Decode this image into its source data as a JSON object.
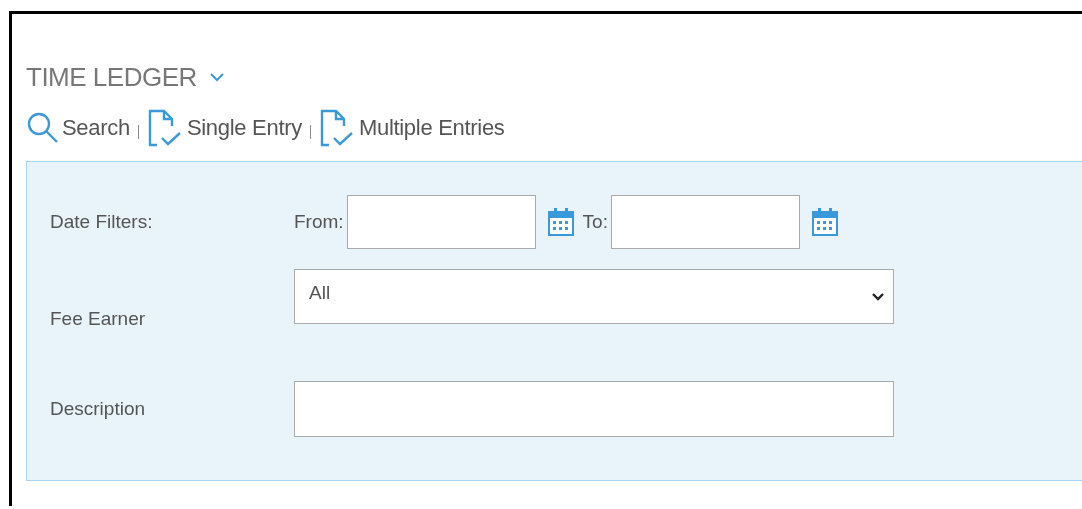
{
  "header": {
    "title": "TIME LEDGER"
  },
  "toolbar": [
    {
      "kind": "search",
      "label": "Search"
    },
    {
      "kind": "document",
      "label": "Single Entry"
    },
    {
      "kind": "document",
      "label": "Multiple Entries"
    }
  ],
  "filters": {
    "date": {
      "label": "Date Filters:",
      "from_label": "From:",
      "to_label": "To:"
    },
    "fee_earner": {
      "label": "Fee Earner",
      "value": "All"
    },
    "description": {
      "label": "Description"
    }
  }
}
